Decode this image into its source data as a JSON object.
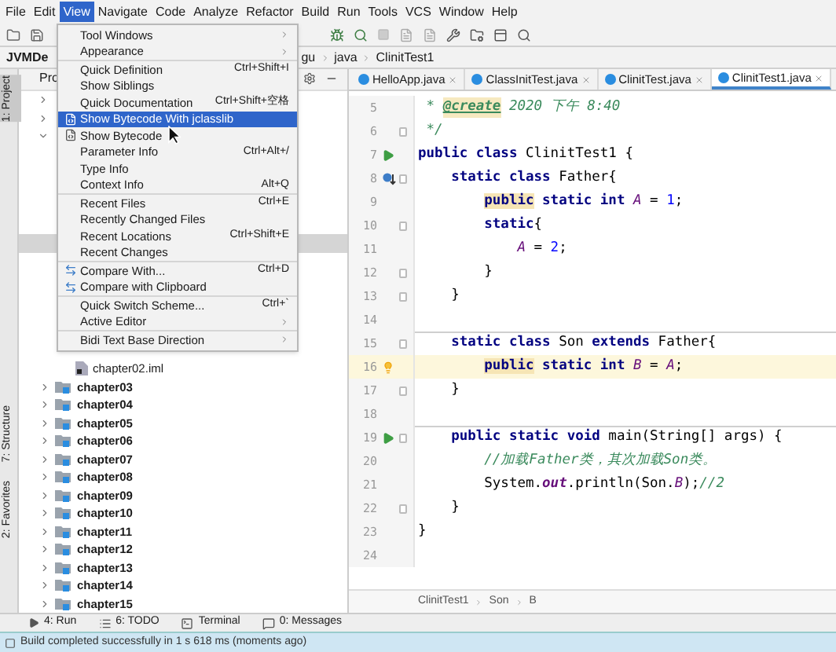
{
  "menubar": [
    {
      "label": "File",
      "selected": false
    },
    {
      "label": "Edit",
      "selected": false
    },
    {
      "label": "View",
      "selected": true
    },
    {
      "label": "Navigate",
      "selected": false
    },
    {
      "label": "Code",
      "selected": false
    },
    {
      "label": "Analyze",
      "selected": false
    },
    {
      "label": "Refactor",
      "selected": false
    },
    {
      "label": "Build",
      "selected": false
    },
    {
      "label": "Run",
      "selected": false
    },
    {
      "label": "Tools",
      "selected": false
    },
    {
      "label": "VCS",
      "selected": false
    },
    {
      "label": "Window",
      "selected": false
    },
    {
      "label": "Help",
      "selected": false
    }
  ],
  "menu": [
    {
      "kind": "plain",
      "label": "Tool Windows",
      "submenu": true,
      "selected": false
    },
    {
      "kind": "plain",
      "label": "Appearance",
      "submenu": true,
      "selected": false
    },
    {
      "kind": "separator"
    },
    {
      "kind": "plain",
      "label": "Quick Definition",
      "shortcut": "Ctrl+Shift+I",
      "submenu": false,
      "selected": false
    },
    {
      "kind": "plain",
      "label": "Show Siblings",
      "submenu": false,
      "selected": false
    },
    {
      "kind": "plain",
      "label": "Quick Documentation",
      "shortcut": "Ctrl+Shift+空格",
      "submenu": false,
      "selected": false
    },
    {
      "kind": "bytecode",
      "label": "Show Bytecode With jclasslib",
      "submenu": false,
      "selected": true
    },
    {
      "kind": "bytecode",
      "label": "Show Bytecode",
      "submenu": false,
      "selected": false
    },
    {
      "kind": "plain",
      "label": "Parameter Info",
      "shortcut": "Ctrl+Alt+/",
      "submenu": false,
      "selected": false
    },
    {
      "kind": "plain",
      "label": "Type Info",
      "submenu": false,
      "selected": false
    },
    {
      "kind": "plain",
      "label": "Context Info",
      "shortcut": "Alt+Q",
      "submenu": false,
      "selected": false
    },
    {
      "kind": "separator"
    },
    {
      "kind": "plain",
      "label": "Recent Files",
      "shortcut": "Ctrl+E",
      "submenu": false,
      "selected": false
    },
    {
      "kind": "plain",
      "label": "Recently Changed Files",
      "submenu": false,
      "selected": false
    },
    {
      "kind": "plain",
      "label": "Recent Locations",
      "shortcut": "Ctrl+Shift+E",
      "submenu": false,
      "selected": false
    },
    {
      "kind": "plain",
      "label": "Recent Changes",
      "submenu": false,
      "selected": false
    },
    {
      "kind": "separator"
    },
    {
      "kind": "compare",
      "label": "Compare With...",
      "shortcut": "Ctrl+D",
      "submenu": false,
      "selected": false
    },
    {
      "kind": "compare",
      "label": "Compare with Clipboard",
      "submenu": false,
      "selected": false
    },
    {
      "kind": "separator"
    },
    {
      "kind": "plain",
      "label": "Quick Switch Scheme...",
      "shortcut": "Ctrl+`",
      "submenu": false,
      "selected": false
    },
    {
      "kind": "plain",
      "label": "Active Editor",
      "submenu": true,
      "selected": false
    },
    {
      "kind": "separator"
    },
    {
      "kind": "plain",
      "label": "Bidi Text Base Direction",
      "submenu": true,
      "selected": false
    }
  ],
  "navbar": [
    "JVMDe",
    "gu",
    "java",
    "ClinitTest1"
  ],
  "side_strip": [
    {
      "label": "1: Project",
      "selected": true
    },
    {
      "label": "7: Structure",
      "selected": false
    },
    {
      "label": "2: Favorites",
      "selected": false
    }
  ],
  "project_panel": {
    "title": "Pro",
    "hidden_rows": [
      {
        "kind": "collapsed"
      },
      {
        "kind": "collapsed"
      },
      {
        "kind": "expanded"
      },
      {
        "kind": "blank"
      },
      {
        "kind": "blank"
      },
      {
        "kind": "blank"
      },
      {
        "kind": "blank"
      },
      {
        "kind": "blank"
      },
      {
        "kind": "selected"
      },
      {
        "kind": "blank"
      },
      {
        "kind": "blank"
      },
      {
        "kind": "blank"
      },
      {
        "kind": "blank"
      },
      {
        "kind": "blank"
      },
      {
        "kind": "blank"
      }
    ],
    "items": [
      {
        "kind": "file",
        "label": "chapter02.iml"
      },
      {
        "kind": "module",
        "label": "chapter03",
        "expanded": false
      },
      {
        "kind": "module",
        "label": "chapter04",
        "expanded": false
      },
      {
        "kind": "module",
        "label": "chapter05",
        "expanded": false
      },
      {
        "kind": "module",
        "label": "chapter06",
        "expanded": false
      },
      {
        "kind": "module",
        "label": "chapter07",
        "expanded": false
      },
      {
        "kind": "module",
        "label": "chapter08",
        "expanded": false
      },
      {
        "kind": "module",
        "label": "chapter09",
        "expanded": false
      },
      {
        "kind": "module",
        "label": "chapter10",
        "expanded": false
      },
      {
        "kind": "module",
        "label": "chapter11",
        "expanded": false
      },
      {
        "kind": "module",
        "label": "chapter12",
        "expanded": false
      },
      {
        "kind": "module",
        "label": "chapter13",
        "expanded": false
      },
      {
        "kind": "module",
        "label": "chapter14",
        "expanded": false
      },
      {
        "kind": "module",
        "label": "chapter15",
        "expanded": false
      }
    ]
  },
  "tabs": [
    {
      "label": "HelloApp.java",
      "selected": false
    },
    {
      "label": "ClassInitTest.java",
      "selected": false
    },
    {
      "label": "ClinitTest.java",
      "selected": false
    },
    {
      "label": "ClinitTest1.java",
      "selected": true
    }
  ],
  "code": [
    {
      "number": "5",
      "kind": "plain",
      "fold": false,
      "current": false,
      "separator": false,
      "tokens": [
        {
          "text": " * ",
          "kind": "doc"
        },
        {
          "text": "@create",
          "kind": "doc-tag"
        },
        {
          "text": " 2020 下午 8:40",
          "kind": "doc"
        }
      ]
    },
    {
      "number": "6",
      "kind": "plain",
      "fold": true,
      "current": false,
      "separator": false,
      "tokens": [
        {
          "text": " */",
          "kind": "doc"
        }
      ]
    },
    {
      "number": "7",
      "kind": "run",
      "fold": false,
      "current": false,
      "separator": false,
      "tokens": [
        {
          "text": "public class ",
          "kind": "keyword"
        },
        {
          "text": "ClinitTest1 {",
          "kind": "plain"
        }
      ]
    },
    {
      "number": "8",
      "kind": "override",
      "fold": true,
      "current": false,
      "separator": false,
      "tokens": [
        {
          "text": "    static class ",
          "kind": "keyword"
        },
        {
          "text": "Father{",
          "kind": "plain"
        }
      ]
    },
    {
      "number": "9",
      "kind": "plain",
      "fold": false,
      "current": false,
      "separator": false,
      "tokens": [
        {
          "text": "        public",
          "kind": "keyword-marked"
        },
        {
          "text": " static int ",
          "kind": "keyword"
        },
        {
          "text": "A",
          "kind": "field"
        },
        {
          "text": " = ",
          "kind": "plain"
        },
        {
          "text": "1",
          "kind": "number"
        },
        {
          "text": ";",
          "kind": "plain"
        }
      ]
    },
    {
      "number": "10",
      "kind": "plain",
      "fold": true,
      "current": false,
      "separator": false,
      "tokens": [
        {
          "text": "        static",
          "kind": "keyword"
        },
        {
          "text": "{",
          "kind": "plain"
        }
      ]
    },
    {
      "number": "11",
      "kind": "plain",
      "fold": false,
      "current": false,
      "separator": false,
      "tokens": [
        {
          "text": "            A",
          "kind": "field"
        },
        {
          "text": " = ",
          "kind": "plain"
        },
        {
          "text": "2",
          "kind": "number"
        },
        {
          "text": ";",
          "kind": "plain"
        }
      ]
    },
    {
      "number": "12",
      "kind": "plain",
      "fold": true,
      "current": false,
      "separator": false,
      "tokens": [
        {
          "text": "        }",
          "kind": "plain"
        }
      ]
    },
    {
      "number": "13",
      "kind": "plain",
      "fold": true,
      "current": false,
      "separator": false,
      "tokens": [
        {
          "text": "    }",
          "kind": "plain"
        }
      ]
    },
    {
      "number": "14",
      "kind": "plain",
      "fold": false,
      "current": false,
      "separator": false
    },
    {
      "number": "15",
      "kind": "plain",
      "fold": true,
      "current": false,
      "separator": true,
      "tokens": [
        {
          "text": "    static class ",
          "kind": "keyword"
        },
        {
          "text": "Son ",
          "kind": "plain"
        },
        {
          "text": "extends ",
          "kind": "keyword"
        },
        {
          "text": "Father{",
          "kind": "plain"
        }
      ]
    },
    {
      "number": "16",
      "kind": "bulb",
      "fold": false,
      "current": true,
      "separator": false,
      "tokens": [
        {
          "text": "        public",
          "kind": "keyword-marked"
        },
        {
          "text": " static int ",
          "kind": "keyword"
        },
        {
          "text": "B",
          "kind": "field"
        },
        {
          "text": " = ",
          "kind": "plain"
        },
        {
          "text": "A",
          "kind": "field"
        },
        {
          "text": ";",
          "kind": "plain"
        }
      ]
    },
    {
      "number": "17",
      "kind": "plain",
      "fold": true,
      "current": false,
      "separator": false,
      "tokens": [
        {
          "text": "    }",
          "kind": "plain"
        }
      ]
    },
    {
      "number": "18",
      "kind": "plain",
      "fold": false,
      "current": false,
      "separator": false
    },
    {
      "number": "19",
      "kind": "run",
      "fold": true,
      "current": false,
      "separator": true,
      "tokens": [
        {
          "text": "    public static void ",
          "kind": "keyword"
        },
        {
          "text": "main(String[] args) {",
          "kind": "plain"
        }
      ]
    },
    {
      "number": "20",
      "kind": "plain",
      "fold": false,
      "current": false,
      "separator": false,
      "tokens": [
        {
          "text": "        //加载Father类，其次加载Son类。",
          "kind": "comment"
        }
      ]
    },
    {
      "number": "21",
      "kind": "plain",
      "fold": false,
      "current": false,
      "separator": false,
      "tokens": [
        {
          "text": "        System.",
          "kind": "plain"
        },
        {
          "text": "out",
          "kind": "static-ref"
        },
        {
          "text": ".println(Son.",
          "kind": "plain"
        },
        {
          "text": "B",
          "kind": "field"
        },
        {
          "text": ");",
          "kind": "plain"
        },
        {
          "text": "//2",
          "kind": "comment"
        }
      ]
    },
    {
      "number": "22",
      "kind": "plain",
      "fold": true,
      "current": false,
      "separator": false,
      "tokens": [
        {
          "text": "    }",
          "kind": "plain"
        }
      ]
    },
    {
      "number": "23",
      "kind": "plain",
      "fold": false,
      "current": false,
      "separator": false,
      "tokens": [
        {
          "text": "}",
          "kind": "plain"
        }
      ]
    },
    {
      "number": "24",
      "kind": "plain",
      "fold": false,
      "current": false,
      "separator": false
    }
  ],
  "editor_breadcrumb": [
    "ClinitTest1",
    "Son",
    "B"
  ],
  "tool_buttons": [
    {
      "kind": "run",
      "label": "4: Run"
    },
    {
      "kind": "todo",
      "label": "6: TODO"
    },
    {
      "kind": "terminal",
      "label": "Terminal"
    },
    {
      "kind": "messages",
      "label": "0: Messages"
    }
  ],
  "status_bar": "Build completed successfully in 1 s 618 ms (moments ago)"
}
